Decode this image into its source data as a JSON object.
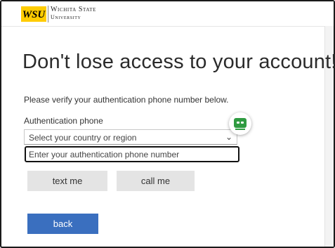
{
  "header": {
    "logo_mark": "WSU",
    "university_line1": "Wichita State",
    "university_line2": "University"
  },
  "main": {
    "title": "Don't lose access to your account!",
    "instruction": "Please verify your authentication phone number below.",
    "phone_label": "Authentication phone",
    "country_select_value": "Select your country or region",
    "phone_placeholder": "Enter your authentication phone number"
  },
  "buttons": {
    "text_me": "text me",
    "call_me": "call me",
    "back": "back"
  },
  "colors": {
    "primary": "#3a6fbf",
    "badge_green": "#2f9b41",
    "secondary_button": "#e4e4e4"
  },
  "icons": {
    "select_chevron": "chevron-down-icon",
    "extension_badge": "password-manager-icon"
  }
}
